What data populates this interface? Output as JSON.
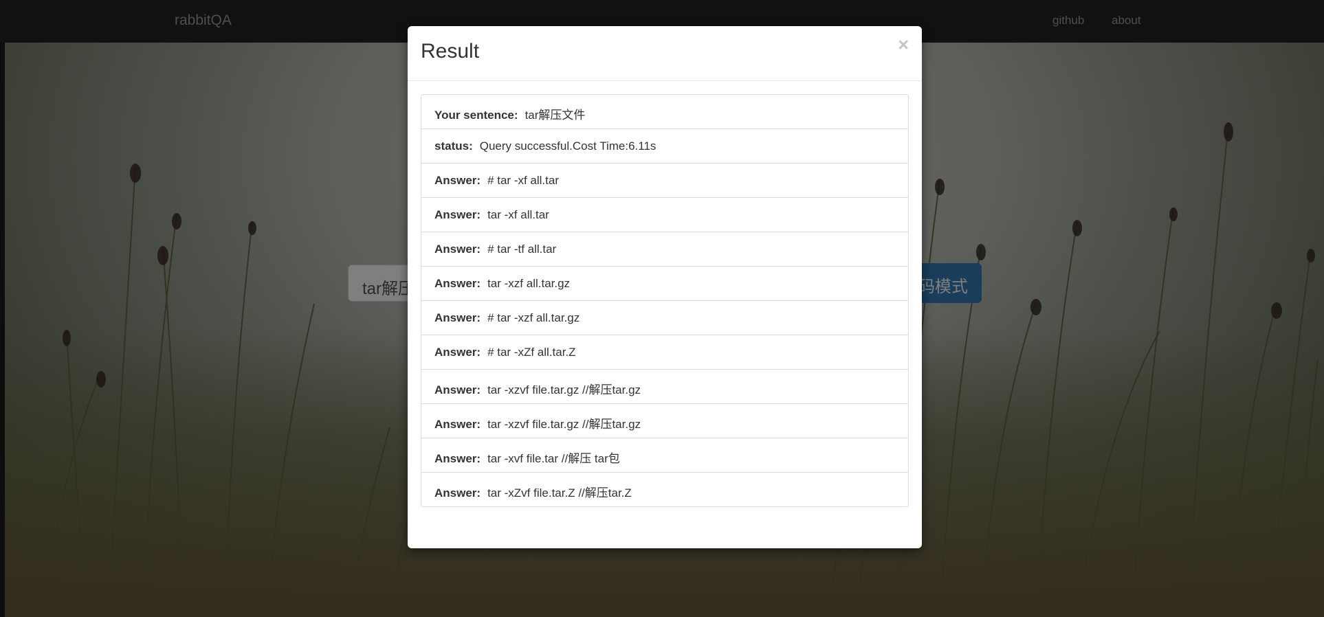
{
  "navbar": {
    "brand": "rabbitQA",
    "links": [
      "github",
      "about"
    ]
  },
  "search": {
    "value": "tar解压文件",
    "mode_button_label": "代码模式"
  },
  "modal": {
    "title": "Result",
    "close_glyph": "×",
    "sentence": {
      "label": "Your sentence:",
      "value": "tar解压文件"
    },
    "status": {
      "label": "status:",
      "value": "Query successful.Cost Time:6.11s"
    },
    "answer_label": "Answer:",
    "answers": [
      "# tar -xf all.tar",
      "tar -xf all.tar",
      "# tar -tf all.tar",
      "tar -xzf all.tar.gz",
      "# tar -xzf all.tar.gz",
      "# tar -xZf all.tar.Z",
      "tar -xzvf file.tar.gz //解压tar.gz",
      "tar -xzvf file.tar.gz //解压tar.gz",
      "tar -xvf file.tar //解压 tar包",
      "tar -xZvf file.tar.Z //解压tar.Z"
    ]
  },
  "colors": {
    "navbar_bg": "#222222",
    "primary_button": "#337ab7",
    "overlay": "rgba(0,0,0,0.5)"
  }
}
